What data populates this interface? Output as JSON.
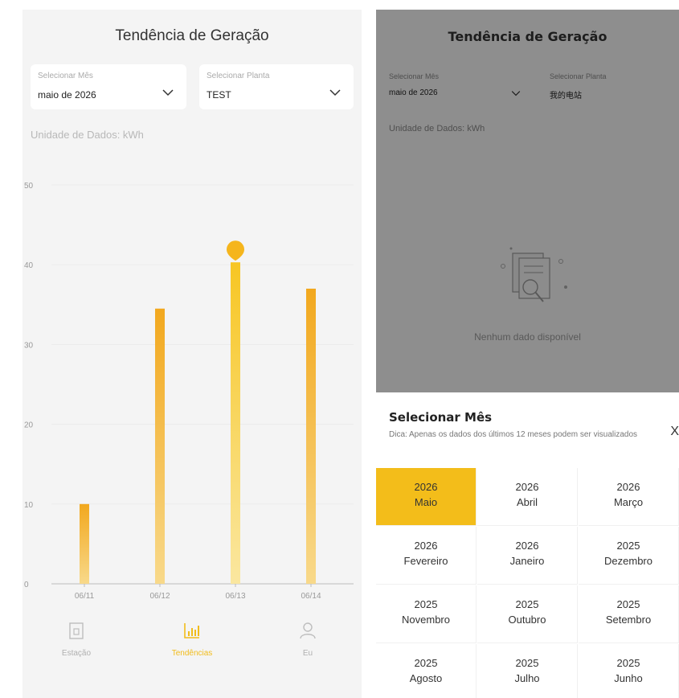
{
  "left": {
    "title": "Tendência de Geração",
    "month_selector": {
      "label": "Selecionar Mês",
      "value": "maio de 2026"
    },
    "plant_selector": {
      "label": "Selecionar Planta",
      "value": "TEST"
    },
    "unit": "Unidade de Dados:  kWh",
    "tabs": [
      {
        "label": "Estação",
        "icon": "station-icon",
        "active": false
      },
      {
        "label": "Tendências",
        "icon": "bar-chart-icon",
        "active": true
      },
      {
        "label": "Eu",
        "icon": "person-icon",
        "active": false
      }
    ]
  },
  "chart_data": {
    "type": "bar",
    "categories": [
      "06/11",
      "06/12",
      "06/13",
      "06/14"
    ],
    "values": [
      10,
      34.5,
      40.3,
      37
    ],
    "highlighted_index": 2,
    "ylim": [
      0,
      50
    ],
    "yticks": [
      0,
      10,
      20,
      30,
      40,
      50
    ],
    "grid": true,
    "colors": {
      "bar_top": "#f2a81e",
      "bar_bottom": "#f8d98a",
      "highlight_top": "#f7c623",
      "highlight_bottom": "#fae7a0",
      "marker": "#f5b51c"
    }
  },
  "right": {
    "title": "Tendência de Geração",
    "month_selector": {
      "label": "Selecionar Mês",
      "value": "maio de 2026"
    },
    "plant_selector": {
      "label": "Selecionar Planta",
      "value": "我的电站"
    },
    "unit": "Unidade de Dados:  kWh",
    "empty_text": "Nenhum dado disponível",
    "sheet": {
      "title": "Selecionar Mês",
      "hint": "Dica: Apenas os dados dos últimos 12 meses podem ser visualizados",
      "close": "X",
      "months": [
        {
          "year": "2026",
          "month": "Maio",
          "selected": true
        },
        {
          "year": "2026",
          "month": "Abril",
          "selected": false
        },
        {
          "year": "2026",
          "month": "Março",
          "selected": false
        },
        {
          "year": "2026",
          "month": "Fevereiro",
          "selected": false
        },
        {
          "year": "2026",
          "month": "Janeiro",
          "selected": false
        },
        {
          "year": "2025",
          "month": "Dezembro",
          "selected": false
        },
        {
          "year": "2025",
          "month": "Novembro",
          "selected": false
        },
        {
          "year": "2025",
          "month": "Outubro",
          "selected": false
        },
        {
          "year": "2025",
          "month": "Setembro",
          "selected": false
        },
        {
          "year": "2025",
          "month": "Agosto",
          "selected": false
        },
        {
          "year": "2025",
          "month": "Julho",
          "selected": false
        },
        {
          "year": "2025",
          "month": "Junho",
          "selected": false
        }
      ]
    },
    "accent": "#f3bd1a"
  }
}
